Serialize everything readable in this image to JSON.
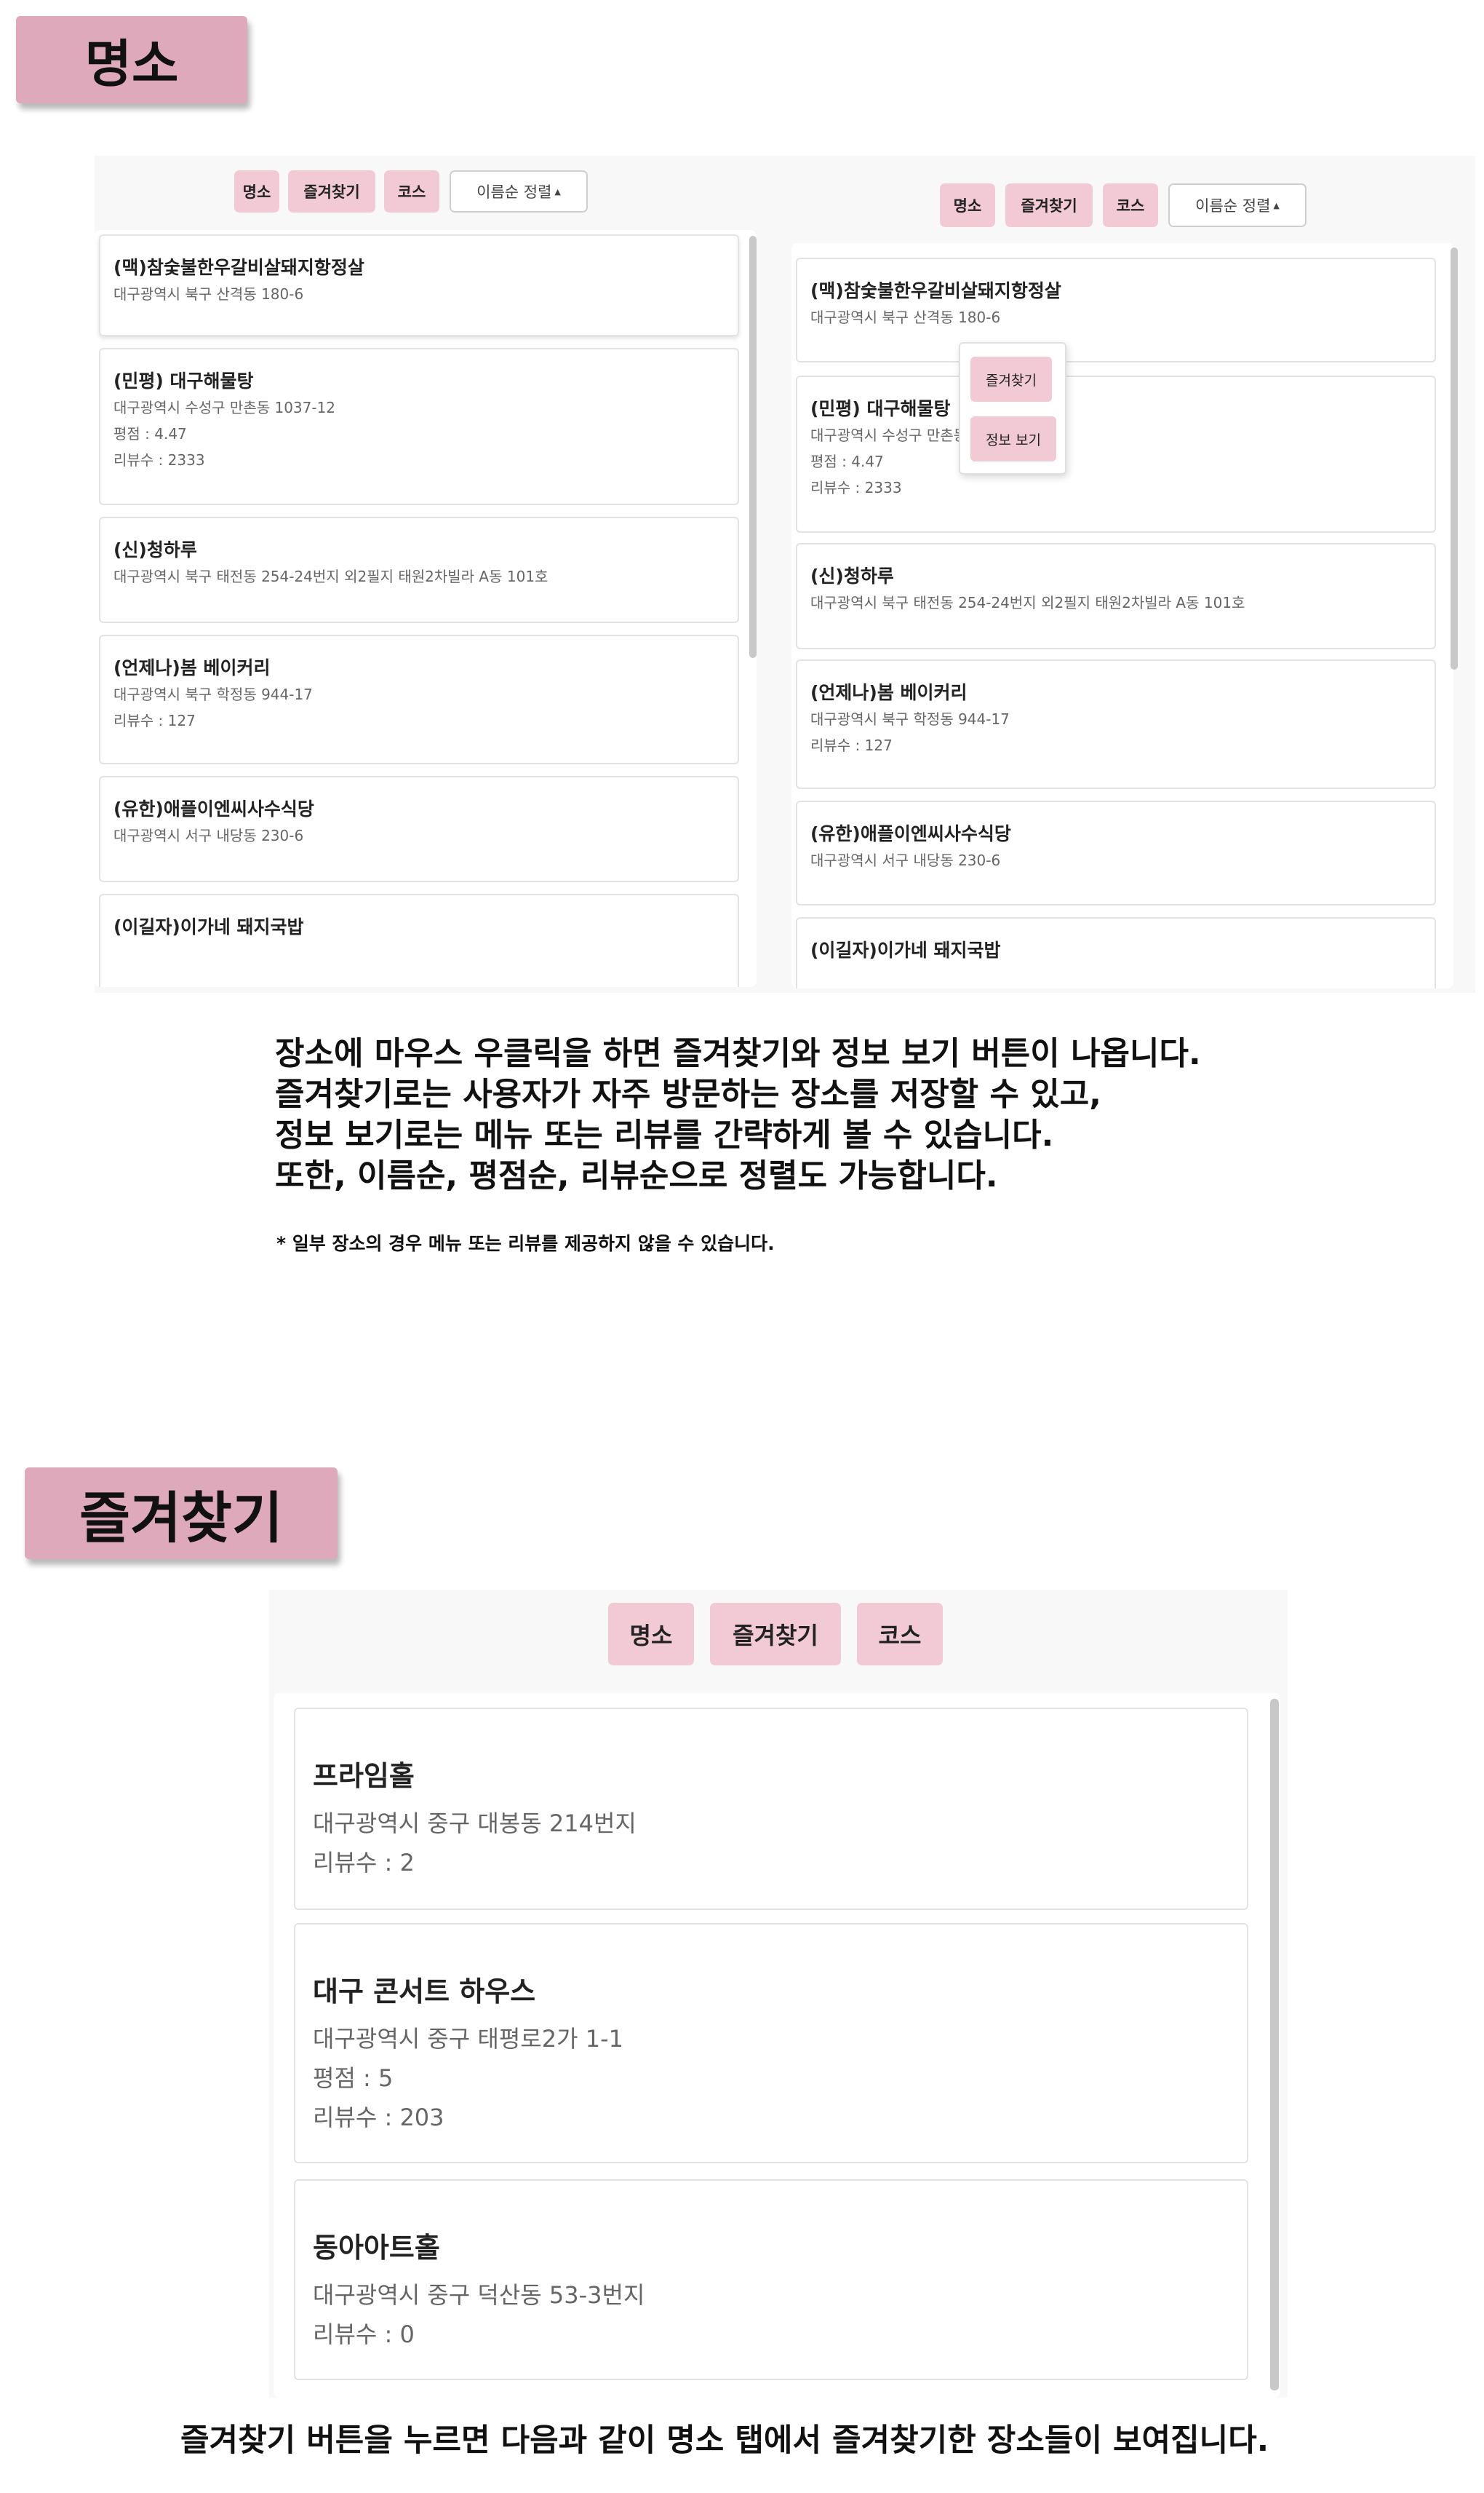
{
  "sections": {
    "places": {
      "title": "명소"
    },
    "favorites": {
      "title": "즐겨찾기"
    }
  },
  "tabs": {
    "places": "명소",
    "favorites": "즐겨찾기",
    "course": "코스"
  },
  "sort": {
    "label": "이름순 정렬",
    "arrow": "▲"
  },
  "context_menu": {
    "favorite": "즐겨찾기",
    "info": "정보 보기"
  },
  "left_list": [
    {
      "name": "(맥)참숯불한우갈비살돼지항정살",
      "lines": [
        "대구광역시 북구 산격동 180-6"
      ]
    },
    {
      "name": "(민평) 대구해물탕",
      "lines": [
        "대구광역시 수성구 만촌동 1037-12",
        "평점 : 4.47",
        "리뷰수 : 2333"
      ]
    },
    {
      "name": "(신)청하루",
      "lines": [
        "대구광역시 북구 태전동 254-24번지 외2필지 태원2차빌라 A동 101호"
      ]
    },
    {
      "name": "(언제나)봄 베이커리",
      "lines": [
        "대구광역시 북구 학정동 944-17",
        "리뷰수 : 127"
      ]
    },
    {
      "name": "(유한)애플이엔씨사수식당",
      "lines": [
        "대구광역시 서구 내당동 230-6"
      ]
    },
    {
      "name": "(이길자)이가네 돼지국밥",
      "lines": []
    }
  ],
  "right_list": [
    {
      "name": "(맥)참숯불한우갈비살돼지항정살",
      "lines": [
        "대구광역시 북구 산격동 180-6"
      ]
    },
    {
      "name": "(민평) 대구해물탕",
      "lines": [
        "대구광역시 수성구 만촌동 1037-12",
        "평점 : 4.47",
        "리뷰수 : 2333"
      ]
    },
    {
      "name": "(신)청하루",
      "lines": [
        "대구광역시 북구 태전동 254-24번지 외2필지 태원2차빌라 A동 101호"
      ]
    },
    {
      "name": "(언제나)봄 베이커리",
      "lines": [
        "대구광역시 북구 학정동 944-17",
        "리뷰수 : 127"
      ]
    },
    {
      "name": "(유한)애플이엔씨사수식당",
      "lines": [
        "대구광역시 서구 내당동 230-6"
      ]
    },
    {
      "name": "(이길자)이가네 돼지국밥",
      "lines": []
    }
  ],
  "desc1": {
    "lines": [
      "장소에 마우스 우클릭을 하면 즐겨찾기와 정보 보기 버튼이 나옵니다.",
      "즐겨찾기로는 사용자가 자주 방문하는 장소를 저장할 수 있고,",
      "정보 보기로는 메뉴 또는 리뷰를 간략하게 볼 수 있습니다.",
      "또한, 이름순, 평점순, 리뷰순으로 정렬도 가능합니다."
    ],
    "note": "* 일부 장소의 경우 메뉴 또는 리뷰를 제공하지 않을 수 있습니다."
  },
  "fav_list": [
    {
      "name": "프라임홀",
      "lines": [
        "대구광역시 중구 대봉동 214번지",
        "리뷰수 : 2"
      ]
    },
    {
      "name": "대구 콘서트 하우스",
      "lines": [
        "대구광역시 중구 태평로2가 1-1",
        "평점 : 5",
        "리뷰수 : 203"
      ]
    },
    {
      "name": "동아아트홀",
      "lines": [
        "대구광역시 중구 덕산동 53-3번지",
        "리뷰수 : 0"
      ]
    }
  ],
  "desc2": "즐겨찾기 버튼을 누르면 다음과 같이 명소 탭에서 즐겨찾기한 장소들이 보여집니다."
}
